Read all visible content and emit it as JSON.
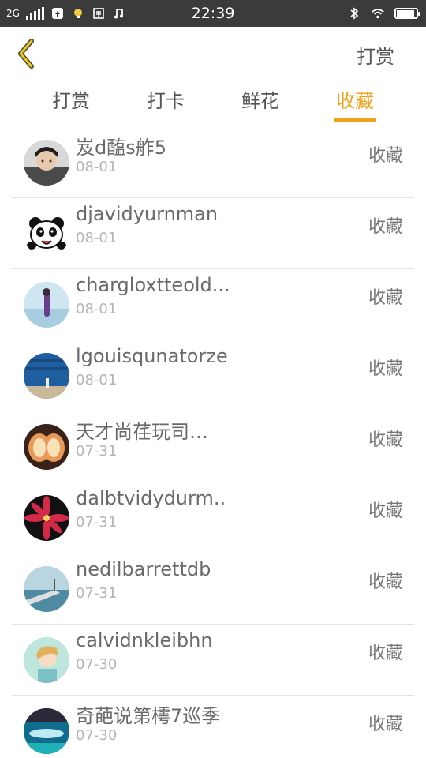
{
  "status_bar": {
    "network": "2G",
    "time": "22:39",
    "battery_level": 0.9,
    "icons": [
      "signal-icon",
      "app-icon",
      "bulb-icon",
      "clipboard-icon",
      "music-icon",
      "bluetooth-icon",
      "wifi-icon",
      "battery-icon"
    ]
  },
  "header": {
    "title": "打赏"
  },
  "tabs": [
    {
      "label": "打赏",
      "active": false
    },
    {
      "label": "打卡",
      "active": false
    },
    {
      "label": "鲜花",
      "active": false
    },
    {
      "label": "收藏",
      "active": true
    }
  ],
  "accent_color": "#f0a31a",
  "list": [
    {
      "name": "岌d醢s舴5",
      "date": "08-01",
      "action": "收藏",
      "avatar": "person-photo"
    },
    {
      "name": "djavidyurnman",
      "date": "08-01",
      "action": "收藏",
      "avatar": "panda-icon"
    },
    {
      "name": "chargloxtteold...",
      "date": "08-01",
      "action": "收藏",
      "avatar": "seaside-photo"
    },
    {
      "name": "lgouisqunatorze",
      "date": "08-01",
      "action": "收藏",
      "avatar": "blue-wall-photo"
    },
    {
      "name": "天才尚荏玩司…",
      "date": "07-31",
      "action": "收藏",
      "avatar": "apple-photo"
    },
    {
      "name": "dalbtvidydurm..",
      "date": "07-31",
      "action": "收藏",
      "avatar": "lily-photo"
    },
    {
      "name": "nedilbarrettdb",
      "date": "07-31",
      "action": "收藏",
      "avatar": "pier-photo"
    },
    {
      "name": "calvidnkleibhn",
      "date": "07-30",
      "action": "收藏",
      "avatar": "anime-photo"
    },
    {
      "name": "奇葩说第樗7巡季",
      "date": "07-30",
      "action": "收藏",
      "avatar": "aquarium-photo"
    }
  ]
}
